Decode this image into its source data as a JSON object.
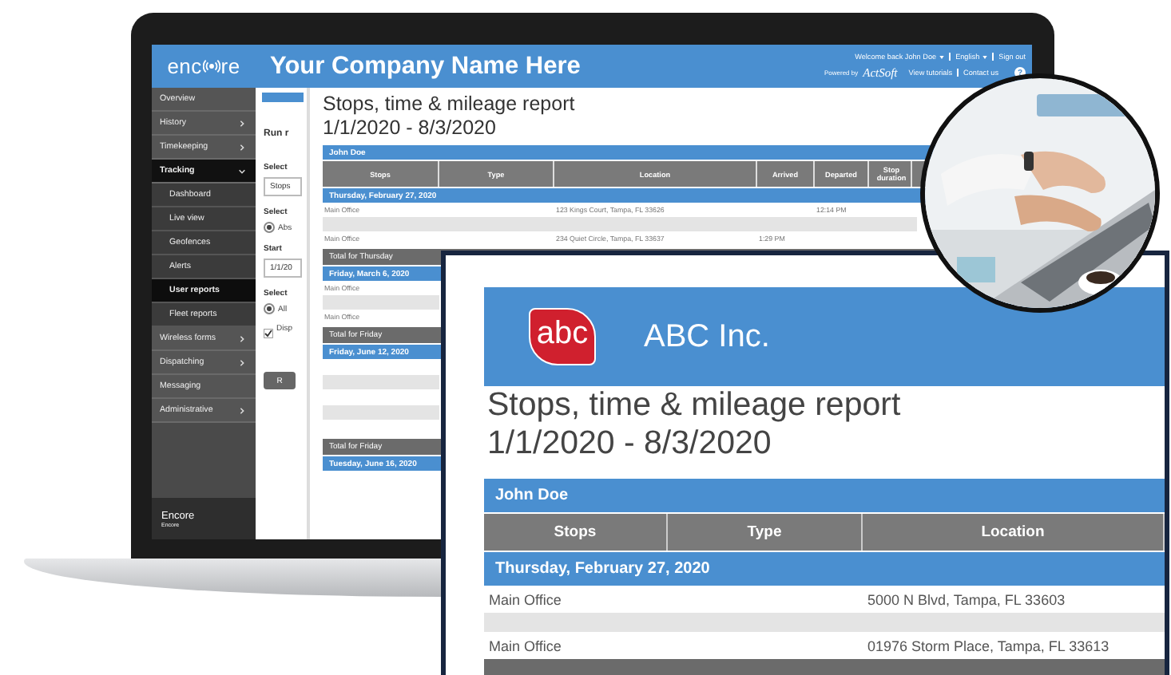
{
  "app": {
    "logo_before": "enc",
    "logo_after": "re",
    "company": "Your Company Name Here",
    "user_links": [
      {
        "label": "Welcome back John Doe",
        "dropdown": true
      },
      {
        "label": "English",
        "dropdown": true
      },
      {
        "label": "Sign out",
        "dropdown": false
      }
    ],
    "powered_by": "Powered by",
    "powered_logo": "ActSoft",
    "help_links": [
      "View tutorials",
      "Contact us"
    ],
    "help_icon": "?"
  },
  "sidebar": {
    "items": [
      {
        "label": "Overview",
        "kind": "link",
        "selected": false
      },
      {
        "label": "History",
        "kind": "group",
        "expanded": false,
        "selected": false
      },
      {
        "label": "Timekeeping",
        "kind": "group",
        "expanded": false,
        "selected": false
      },
      {
        "label": "Tracking",
        "kind": "group",
        "expanded": true,
        "selected": true,
        "children": [
          {
            "label": "Dashboard",
            "selected": false
          },
          {
            "label": "Live view",
            "selected": false
          },
          {
            "label": "Geofences",
            "selected": false
          },
          {
            "label": "Alerts",
            "selected": false
          },
          {
            "label": "User reports",
            "selected": true
          },
          {
            "label": "Fleet reports",
            "selected": false
          }
        ]
      },
      {
        "label": "Wireless forms",
        "kind": "group",
        "expanded": false,
        "selected": false
      },
      {
        "label": "Dispatching",
        "kind": "group",
        "expanded": false,
        "selected": false
      },
      {
        "label": "Messaging",
        "kind": "link",
        "selected": false
      },
      {
        "label": "Administrative",
        "kind": "group",
        "expanded": false,
        "selected": false
      }
    ],
    "footer_title": "Encore",
    "footer_subtitle": "Encore"
  },
  "form": {
    "heading": "Run r",
    "fields": [
      {
        "kind": "label",
        "text": "Select"
      },
      {
        "kind": "select",
        "value": "Stops"
      },
      {
        "kind": "label",
        "text": "Select"
      },
      {
        "kind": "radio",
        "text": "Abs",
        "checked": true
      },
      {
        "kind": "label",
        "text": "Start"
      },
      {
        "kind": "input",
        "value": "1/1/20"
      },
      {
        "kind": "label",
        "text": "Select"
      },
      {
        "kind": "radio",
        "text": "All",
        "checked": true
      },
      {
        "kind": "checkbox",
        "text": "Disp",
        "checked": true
      }
    ],
    "button": "R"
  },
  "report": {
    "title": "Stops, time & mileage report",
    "range": "1/1/2020 - 8/3/2020",
    "person": "John Doe",
    "columns": [
      "Stops",
      "Type",
      "Location",
      "Arrived",
      "Departed",
      "Stop duration"
    ],
    "rows": [
      {
        "kind": "day",
        "text": "Thursday, February 27, 2020"
      },
      {
        "kind": "stop",
        "stop": "Main Office",
        "location": "123 Kings Court, Tampa, FL 33626",
        "departed": "12:14 PM"
      },
      {
        "kind": "blank"
      },
      {
        "kind": "stop",
        "stop": "Main Office",
        "location": "234 Quiet Circle, Tampa, FL 33637",
        "arrived": "1:29 PM"
      },
      {
        "kind": "total",
        "text": "Total for Thursday"
      },
      {
        "kind": "day",
        "text": "Friday, March 6, 2020"
      },
      {
        "kind": "stop",
        "stop": "Main Office"
      },
      {
        "kind": "blank"
      },
      {
        "kind": "stop",
        "stop": "Main Office"
      },
      {
        "kind": "total",
        "text": "Total for Friday"
      },
      {
        "kind": "day",
        "text": "Friday, June 12, 2020"
      },
      {
        "kind": "empty"
      },
      {
        "kind": "blank"
      },
      {
        "kind": "empty"
      },
      {
        "kind": "blank"
      },
      {
        "kind": "empty"
      },
      {
        "kind": "total",
        "text": "Total for Friday"
      },
      {
        "kind": "day",
        "text": "Tuesday, June 16, 2020"
      },
      {
        "kind": "empty"
      }
    ]
  },
  "zoomed_report": {
    "company": "ABC Inc.",
    "logo": "abc",
    "title": "Stops, time & mileage report",
    "range": "1/1/2020 - 8/3/2020",
    "person": "John Doe",
    "columns": [
      "Stops",
      "Type",
      "Location"
    ],
    "rows": [
      {
        "kind": "day",
        "text": "Thursday, February 27, 2020"
      },
      {
        "kind": "stop",
        "stop": "Main Office",
        "location": "5000 N Blvd, Tampa, FL 33603"
      },
      {
        "kind": "blank"
      },
      {
        "kind": "stop",
        "stop": "Main Office",
        "location": "01976 Storm Place, Tampa, FL 33613"
      },
      {
        "kind": "total"
      }
    ]
  }
}
